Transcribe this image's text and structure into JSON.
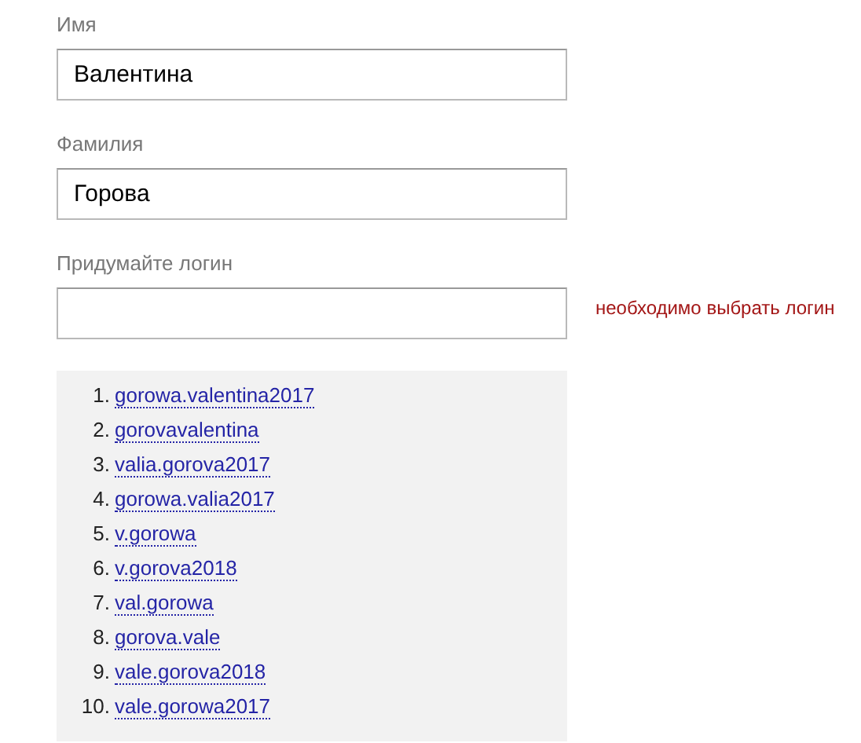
{
  "fields": [
    {
      "label": "Имя",
      "value": "Валентина"
    },
    {
      "label": "Фамилия",
      "value": "Горова"
    },
    {
      "label": "Придумайте логин",
      "error": "необходимо выбрать логин"
    }
  ],
  "suggestions": [
    {
      "number": "1.",
      "login": "gorowa.valentina2017"
    },
    {
      "number": "2.",
      "login": "gorovavalentina"
    },
    {
      "number": "3.",
      "login": "valia.gorova2017"
    },
    {
      "number": "4.",
      "login": "gorowa.valia2017"
    },
    {
      "number": "5.",
      "login": "v.gorowa"
    },
    {
      "number": "6.",
      "login": "v.gorova2018"
    },
    {
      "number": "7.",
      "login": "val.gorowa"
    },
    {
      "number": "8.",
      "login": "gorova.vale"
    },
    {
      "number": "9.",
      "login": "vale.gorova2018"
    },
    {
      "number": "10.",
      "login": "vale.gorowa2017"
    }
  ]
}
